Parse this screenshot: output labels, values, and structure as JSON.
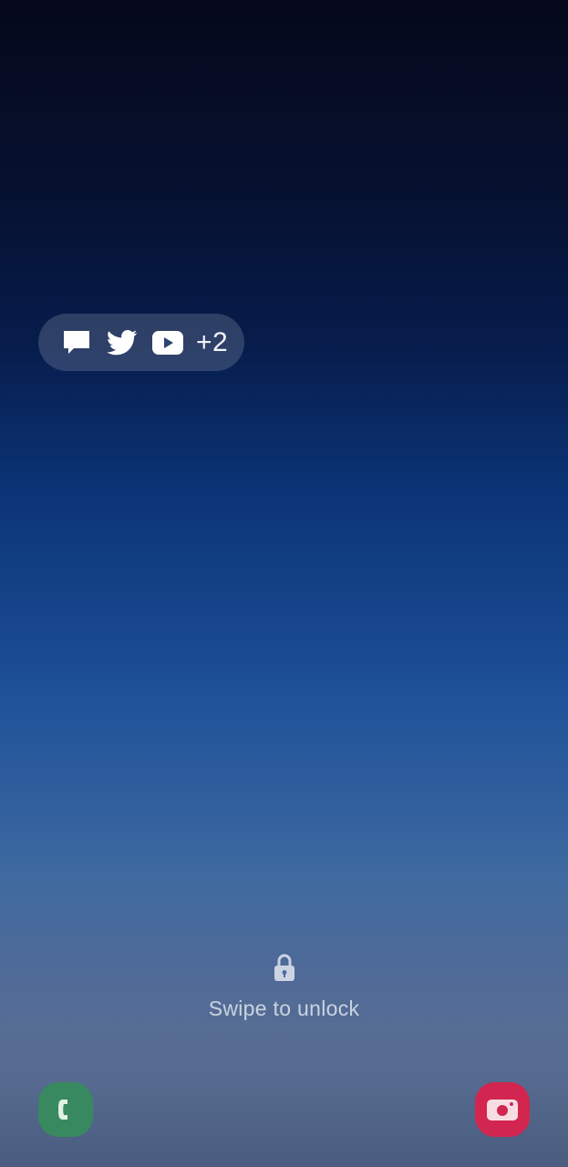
{
  "notifications": {
    "icons": [
      "message-icon",
      "twitter-icon",
      "youtube-icon"
    ],
    "more_count": "+2"
  },
  "lock": {
    "icon": "lock-icon",
    "hint": "Swipe to unlock"
  },
  "shortcuts": {
    "left": {
      "icon": "phone-icon",
      "color": "#38895f"
    },
    "right": {
      "icon": "camera-icon",
      "color": "#d22550"
    }
  }
}
